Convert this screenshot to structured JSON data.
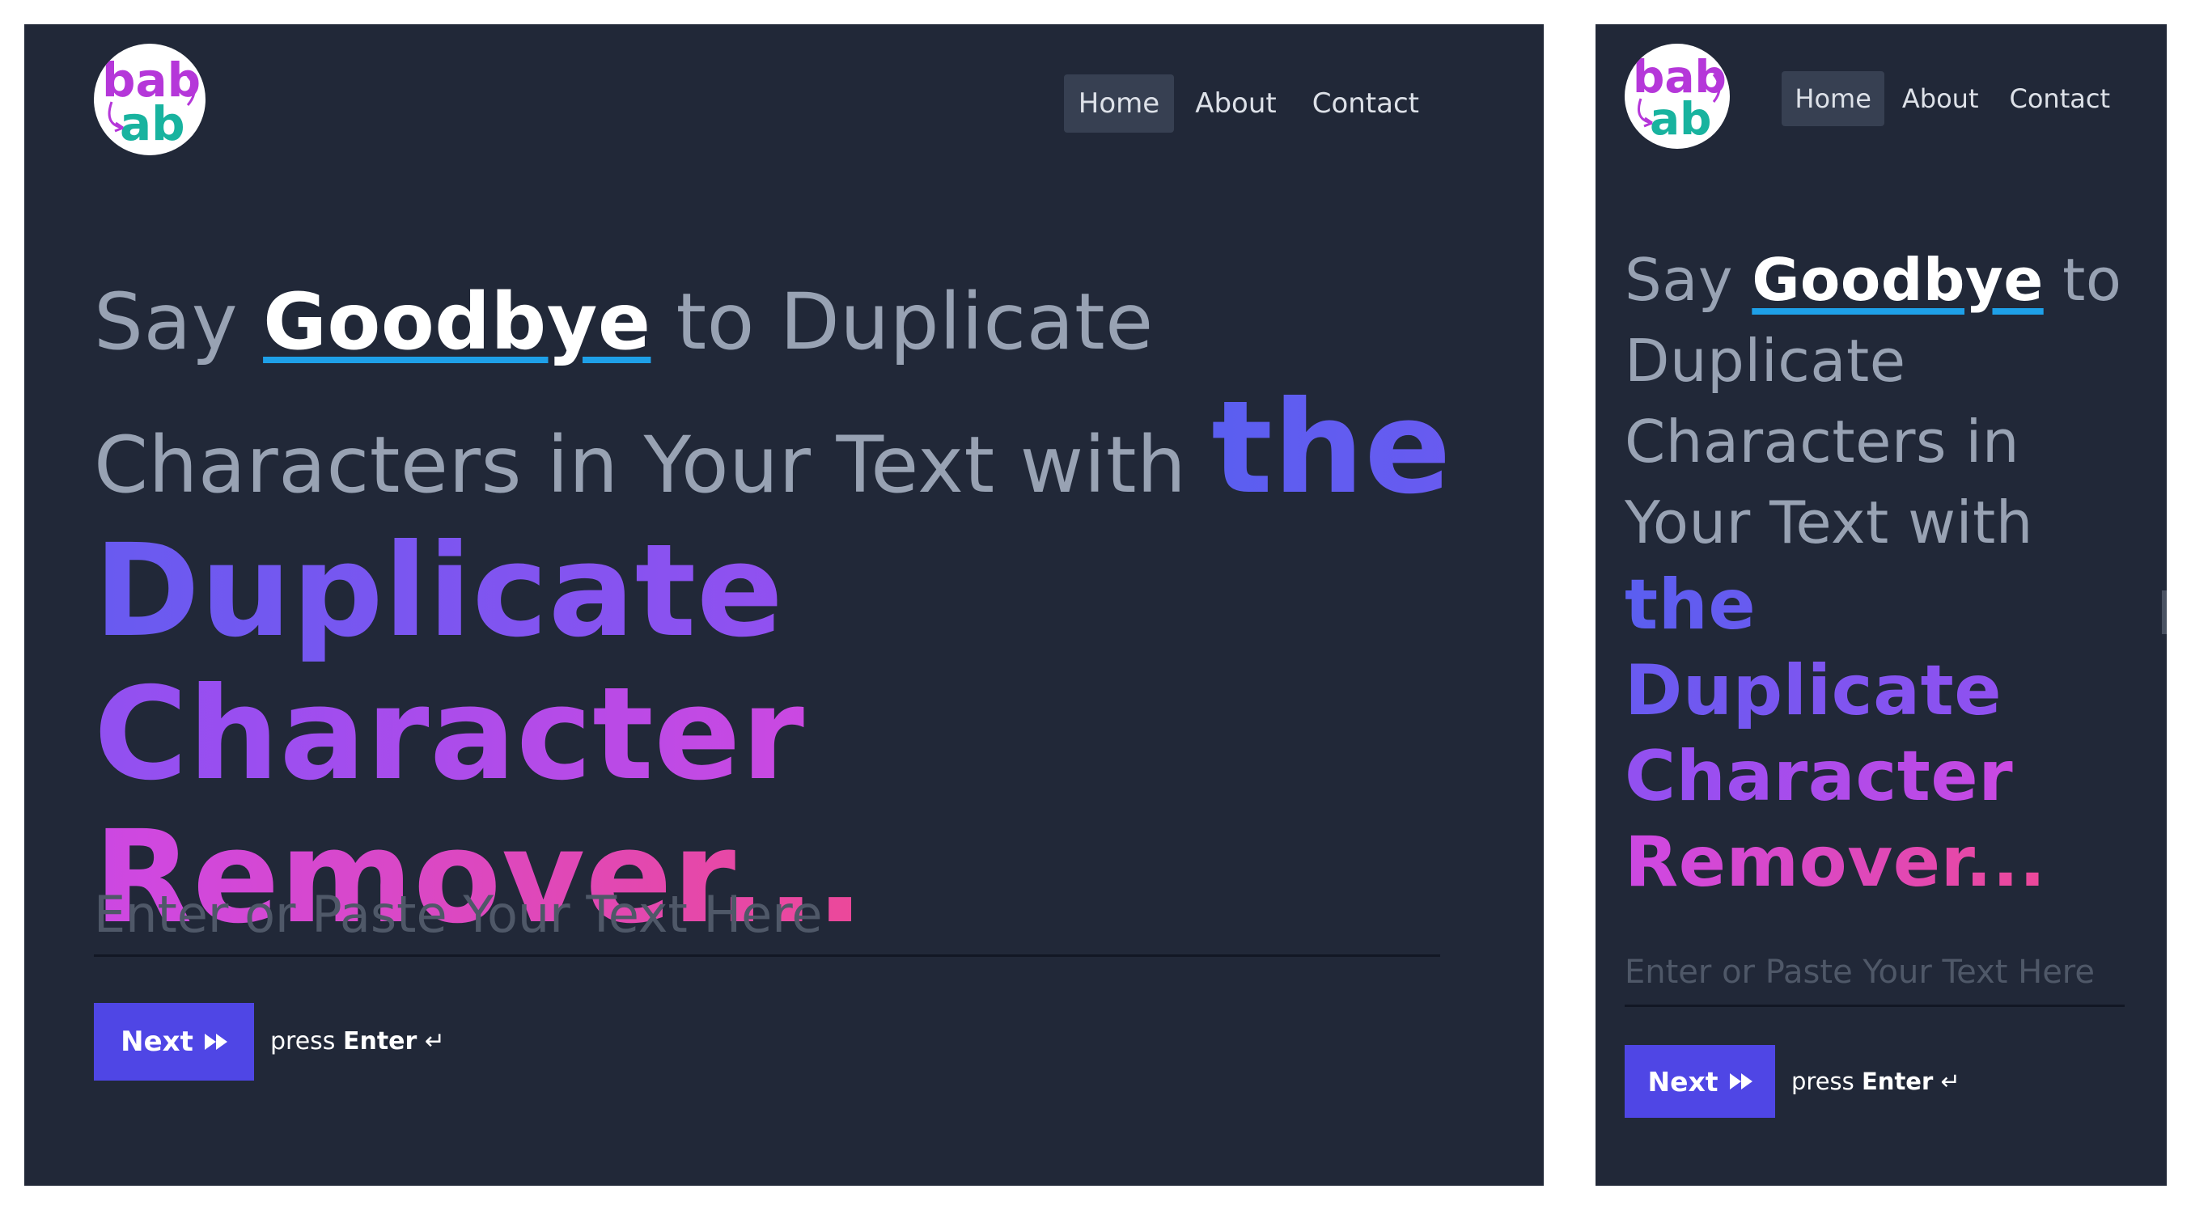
{
  "logo": {
    "line1": "bab",
    "line2": "ab",
    "colors": {
      "primary": "#b537d9",
      "secondary": "#18b39f"
    }
  },
  "nav": {
    "items": [
      {
        "label": "Home",
        "active": true
      },
      {
        "label": "About",
        "active": false
      },
      {
        "label": "Contact",
        "active": false
      }
    ]
  },
  "headline": {
    "prefix": "Say ",
    "highlight": "Goodbye",
    "middle": " to Duplicate Characters in Your Text with ",
    "gradient_text": "the Duplicate Character Remover..."
  },
  "input": {
    "placeholder": "Enter or Paste Your Text Here",
    "value": ""
  },
  "next_button": {
    "label": "Next",
    "icon": "fast-forward-icon"
  },
  "hint": {
    "prefix": "press ",
    "key": "Enter",
    "symbol": "↵"
  },
  "colors": {
    "background": "#212838",
    "accent": "#4f46e5",
    "underline": "#1ea0e8",
    "gradient_start": "#5a5ef0",
    "gradient_end": "#ec4899"
  }
}
